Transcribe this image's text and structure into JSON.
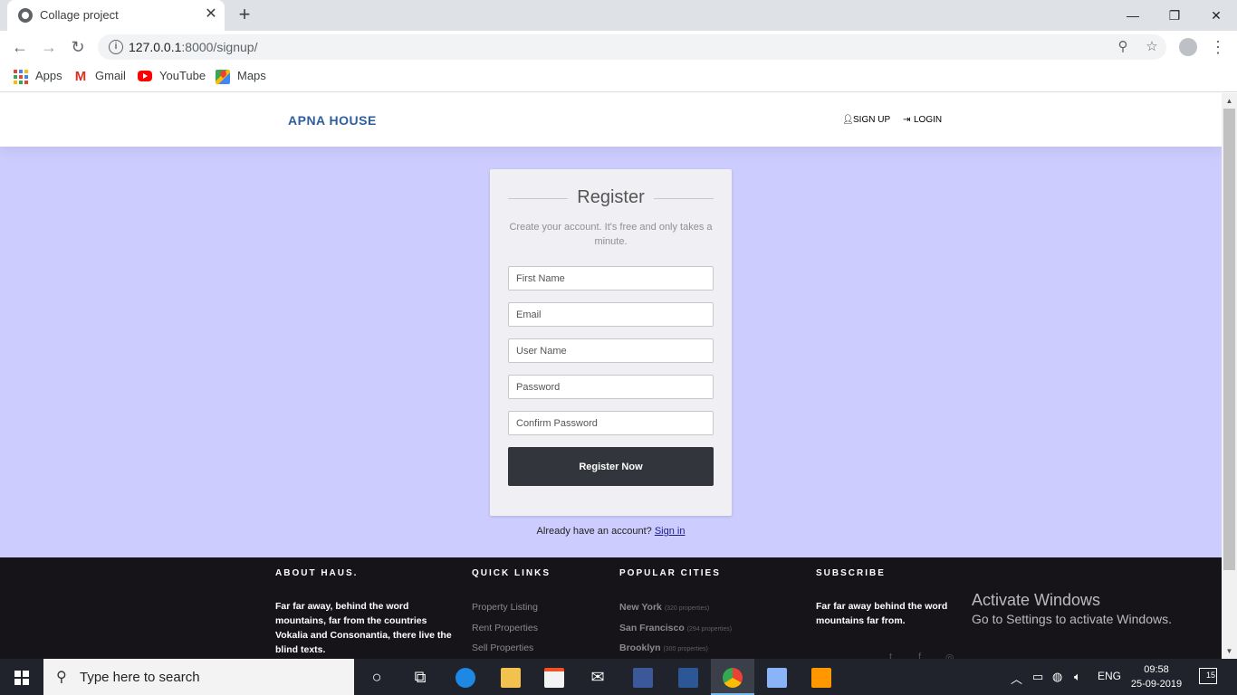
{
  "browser": {
    "tab_title": "Collage project",
    "tab_close": "✕",
    "new_tab": "+",
    "url_host": "127.0.0.1",
    "url_path": ":8000/signup/",
    "window": {
      "minimize": "—",
      "maximize": "❐",
      "close": "✕"
    }
  },
  "bookmarks": [
    {
      "label": "Apps",
      "icon": "apps-grid-icon"
    },
    {
      "label": "Gmail",
      "icon": "gmail-icon"
    },
    {
      "label": "YouTube",
      "icon": "youtube-icon"
    },
    {
      "label": "Maps",
      "icon": "maps-icon"
    }
  ],
  "site": {
    "brand": "APNA HOUSE",
    "nav": {
      "signup": "SIGN UP",
      "login": "LOGIN"
    }
  },
  "register": {
    "title": "Register",
    "subtitle": "Create your account. It's free and only takes a minute.",
    "fields": {
      "first_name": "First Name",
      "email": "Email",
      "username": "User Name",
      "password": "Password",
      "confirm_password": "Confirm Password"
    },
    "button": "Register Now",
    "already_text": "Already have an account?",
    "signin_link": "Sign in"
  },
  "footer": {
    "about": {
      "heading": "ABOUT HAUS.",
      "text": "Far far away, behind the word mountains, far from the countries Vokalia and Consonantia, there live the blind texts."
    },
    "quick_links": {
      "heading": "QUICK LINKS",
      "items": [
        "Property Listing",
        "Rent Properties",
        "Sell Properties"
      ]
    },
    "popular_cities": {
      "heading": "POPULAR CITIES",
      "items": [
        {
          "name": "New York",
          "count": "(320 properties)"
        },
        {
          "name": "San Francisco",
          "count": "(294 properties)"
        },
        {
          "name": "Brooklyn",
          "count": "(300 properties)"
        }
      ]
    },
    "subscribe": {
      "heading": "SUBSCRIBE",
      "text": "Far far away behind the word mountains far from."
    }
  },
  "windows_watermark": {
    "line1": "Activate Windows",
    "line2": "Go to Settings to activate Windows."
  },
  "taskbar": {
    "search_placeholder": "Type here to search",
    "language": "ENG",
    "time": "09:58",
    "date": "25-09-2019",
    "notification_count": "15"
  },
  "colors": {
    "page_bg": "#ccccff",
    "brand": "#2e5e9e",
    "button": "#33353c",
    "footer_bg": "#161319"
  }
}
